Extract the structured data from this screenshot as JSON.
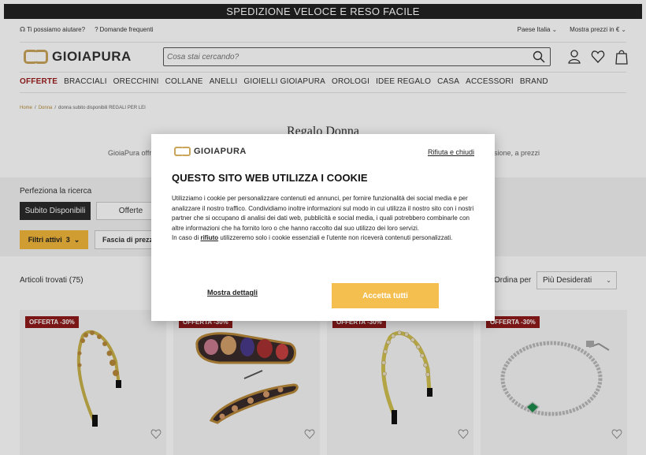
{
  "topbar": {
    "text": "SPEDIZIONE VELOCE E RESO FACILE"
  },
  "util": {
    "help": "Ti possiamo aiutare?",
    "faq": "Domande frequenti",
    "country": "Paese Italia",
    "currency": "Mostra prezzi in €"
  },
  "logo": {
    "text": "GIOIAPURA"
  },
  "search": {
    "placeholder": "Cosa stai cercando?"
  },
  "nav": [
    "OFFERTE",
    "BRACCIALI",
    "ORECCHINI",
    "COLLANE",
    "ANELLI",
    "GIOIELLI GIOIAPURA",
    "OROLOGI",
    "IDEE REGALO",
    "CASA",
    "ACCESSORI",
    "BRAND"
  ],
  "breadcrumb": {
    "home": "Home",
    "sep": "/",
    "level1": "Donna",
    "current": "donna subito disponibili REGALI PER LEI"
  },
  "page": {
    "title": "Regalo Donna",
    "desc_left": "GioiaPura offr",
    "desc_right": "sione, a prezzi"
  },
  "filters": {
    "refine_label": "Perfeziona la ricerca",
    "available": "Subito Disponibili",
    "offer": "Offerte",
    "active": "Filtri attivi",
    "active_count": "3",
    "price": "Fascia di prezzo"
  },
  "results": {
    "count": "Articoli trovati (75)",
    "sort_label": "Ordina per",
    "sort_value": "Più Desiderati"
  },
  "products": [
    {
      "badge": "OFFERTA -30%"
    },
    {
      "badge": "OFFERTA -30%"
    },
    {
      "badge": "OFFERTA -30%"
    },
    {
      "badge": "OFFERTA -30%"
    }
  ],
  "cookie": {
    "logo": "GIOIAPURA",
    "refuse_close": "Rifiuta e chiudi",
    "title": "QUESTO SITO WEB UTILIZZA I COOKIE",
    "body1": "Utilizziamo i cookie per personalizzare contenuti ed annunci, per fornire funzionalità dei social media e per analizzare il nostro traffico. Condividiamo inoltre informazioni sul modo in cui utilizza il nostro sito con i nostri partner che si occupano di analisi dei dati web, pubblicità e social media, i quali potrebbero combinarle con altre informazioni che ha fornito loro o che hanno raccolto dal suo utilizzo dei loro servizi.",
    "body2_pre": "In caso di ",
    "body2_link": "rifiuto",
    "body2_post": " utilizzeremo solo i cookie essenziali e l'utente non riceverà contenuti personalizzati.",
    "details": "Mostra dettagli",
    "accept": "Accetta tutti"
  },
  "colors": {
    "accent": "#f3b73b",
    "offer_red": "#8e1a1a",
    "gold": "#c9a55a"
  }
}
